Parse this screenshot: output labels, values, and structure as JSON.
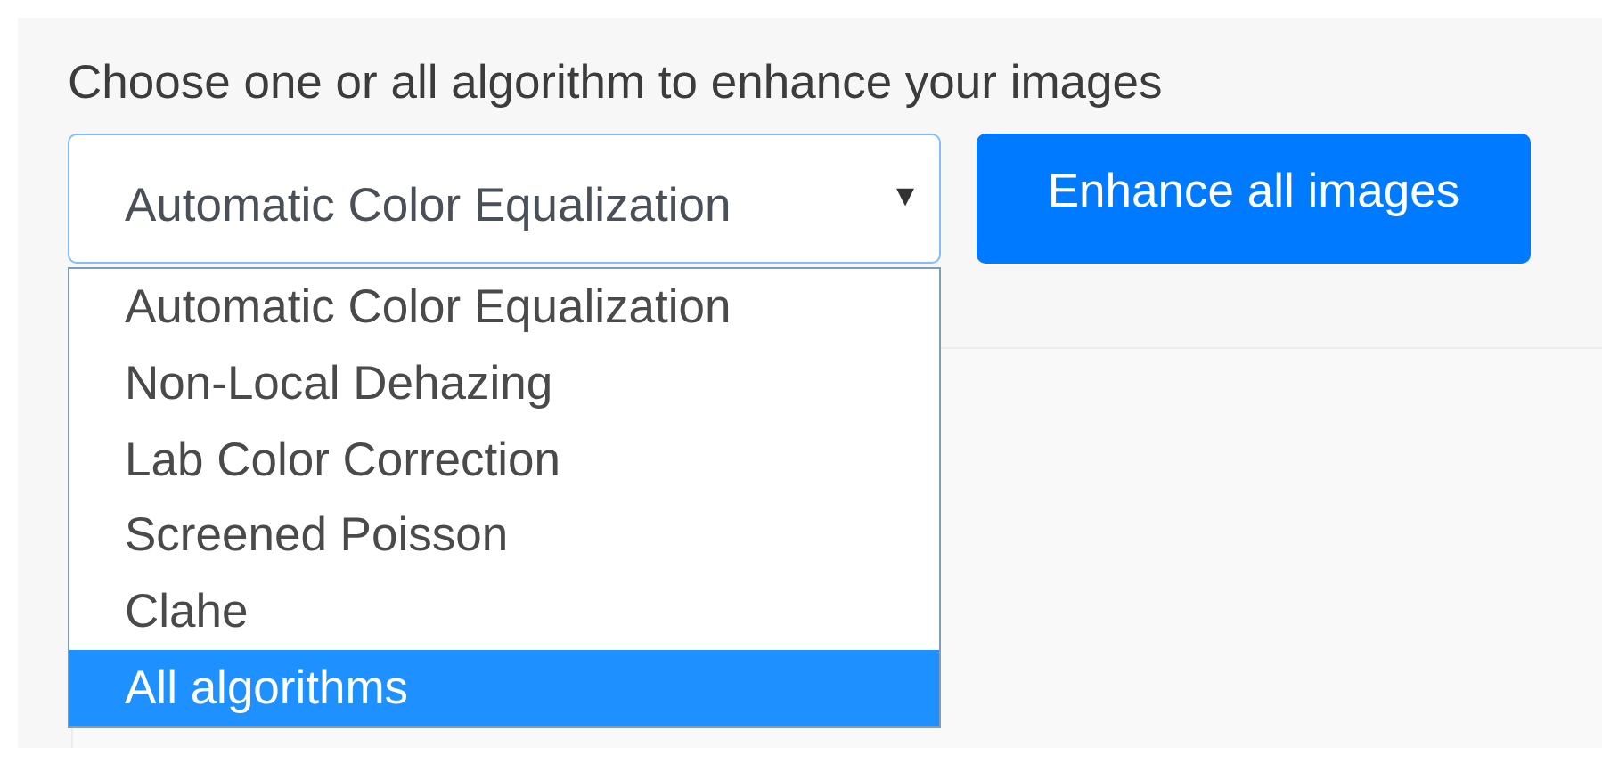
{
  "prompt": "Choose one or all algorithm to enhance your images",
  "select": {
    "value": "Automatic Color Equalization",
    "arrow": "▾",
    "expanded": true
  },
  "options": [
    {
      "label": "Automatic Color Equalization",
      "selected": false
    },
    {
      "label": "Non-Local Dehazing",
      "selected": false
    },
    {
      "label": "Lab Color Correction",
      "selected": false
    },
    {
      "label": "Screened Poisson",
      "selected": false
    },
    {
      "label": "Clahe",
      "selected": false
    },
    {
      "label": "All algorithms",
      "selected": true
    }
  ],
  "button": "Enhance all images"
}
